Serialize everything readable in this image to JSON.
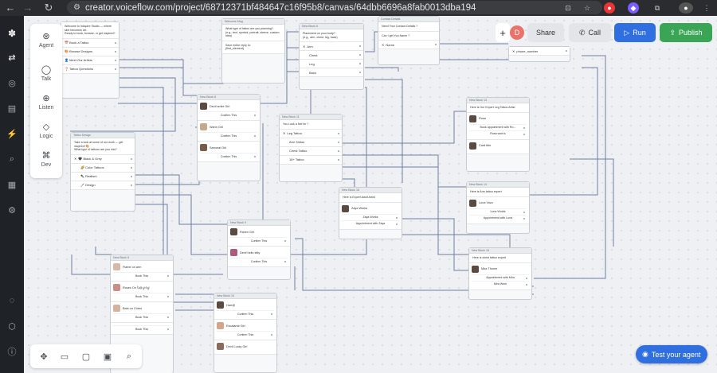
{
  "browser": {
    "url": "creator.voiceflow.com/project/68712371bf484647c16f95b8/canvas/64dbb6696a8fab0013dba194",
    "nav_icons": [
      "back-arrow-icon",
      "forward-arrow-icon",
      "reload-icon"
    ]
  },
  "palette": {
    "items": [
      {
        "label": "Agent",
        "icon": "agent-icon"
      },
      {
        "label": "Talk",
        "icon": "talk-icon"
      },
      {
        "label": "Listen",
        "icon": "listen-icon"
      },
      {
        "label": "Logic",
        "icon": "logic-icon"
      },
      {
        "label": "Dev",
        "icon": "dev-icon"
      }
    ]
  },
  "toolbar": {
    "share_label": "Share",
    "call_label": "Call",
    "run_label": "Run",
    "publish_label": "Publish",
    "avatar_initial": "D",
    "accent": "#2f6fdf",
    "publish_color": "#3aa655"
  },
  "test_agent": {
    "label": "Test your agent"
  },
  "nodes": {
    "start": {
      "message": "Welcome to Inkspire Studio — where skin becomes art.\nReady to book, browse, or get inspired?",
      "buttons": [
        "📅 Book a Tattoo",
        "🎨 Browse Designs",
        "👤 Meet Our Artists",
        "❓ Tattoo Questions"
      ]
    },
    "welcome_msg": {
      "title": "Welcome Msg",
      "message": "What type of tattoo are you planning?\n(e.g., text, symbol, portrait, sleeve, custom idea)",
      "capture": "Save entire reply to:\n{first_element}"
    },
    "block6": {
      "title": "New Block 6",
      "message": "Placement on your body?\n(e.g., arm, chest, leg, back)",
      "options": [
        "Arm",
        "Chest",
        "Leg",
        "Back"
      ]
    },
    "contact": {
      "title": "Contact Details",
      "message": "Need Your Contact Details ?",
      "message2": "Can I get You Name ?",
      "capture": "Name"
    },
    "phone": {
      "capture": "phone_number"
    },
    "tattoo_design": {
      "title": "Tattoo Design",
      "message": "Take a look at some of our work — get inspired! 🎨\nWhat type of tattoos are you into?",
      "options": [
        "🖤 Black & Grey",
        "🌈 Color Tattoos",
        "✒️ Realism",
        "🖌️ Design"
      ]
    },
    "block8": {
      "title": "New Block 8",
      "cards": [
        {
          "name": "Devil smile Girl",
          "button": "Confirm This"
        },
        {
          "name": "Warm Girl",
          "button": "Confirm This"
        },
        {
          "name": "Samurai Girl",
          "button": "Confirm This"
        }
      ]
    },
    "block11": {
      "title": "New Block 11",
      "message": "You Look a Nel for ?",
      "options": [
        "Leg Tattoo",
        "Arm Tattoo",
        "Chest Tattoo",
        "18+ Tattoo"
      ]
    },
    "block13": {
      "title": "New Block 13",
      "message": "Here is Our Expert Leg Tattoo Artist",
      "cards": [
        {
          "name": "Rosa",
          "buttons": [
            "Book appointment with Ro...",
            "Rosa work's"
          ]
        }
      ],
      "extra": "Card title"
    },
    "block14": {
      "title": "New Block 14",
      "message": "Here is Arm tattoo expert",
      "cards": [
        {
          "name": "Luna Vozz",
          "buttons": [
            "Luna Works",
            "Appointment with Luna"
          ]
        }
      ]
    },
    "block15": {
      "title": "New Block 15",
      "message": "Here is chest tattoo expert",
      "cards": [
        {
          "name": "Mira Thorne",
          "buttons": [
            "Appointment with Mira",
            "Mira Work"
          ]
        }
      ]
    },
    "block16": {
      "title": "New Block 16",
      "message": "Here is Expert Adult Artist",
      "cards": [
        {
          "name": "Zaya Works",
          "buttons": [
            "Zaya Works",
            "Appointment with Zaya"
          ]
        }
      ]
    },
    "block9": {
      "title": "New Block 9",
      "cards": [
        {
          "name": "Raven Girl",
          "button": "Confirm This"
        },
        {
          "name": "Devil hello kitty",
          "button": "Confirm This"
        }
      ]
    },
    "block5": {
      "title": "New Block 5",
      "cards": [
        {
          "name": "Flame on arm",
          "button": "Book This"
        },
        {
          "name": "Roses On Ⴆ@ℊ6ℊ",
          "button": "Book This"
        },
        {
          "name": "Bats on Chest",
          "button": "Book This"
        },
        {
          "name": "",
          "button": "Book This"
        }
      ]
    },
    "block10": {
      "title": "New Block 10",
      "cards": [
        {
          "name": "Harr@",
          "button": "Confirm This"
        },
        {
          "name": "Escalante Girl",
          "button": "Confirm This"
        },
        {
          "name": "Devil Lucky Girl",
          "button": ""
        }
      ]
    }
  }
}
